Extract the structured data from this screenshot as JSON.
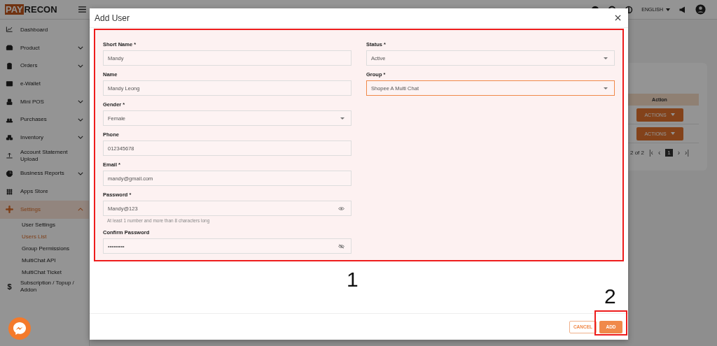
{
  "topbar": {
    "logo": {
      "part_1": "PAY",
      "part_2": "RECON"
    },
    "language": "ENGLISH"
  },
  "sidebar": {
    "items": [
      {
        "label": "Dashboard",
        "selected": false
      },
      {
        "label": "Product",
        "expanded": false,
        "selected": false
      },
      {
        "label": "Orders",
        "expanded": false,
        "selected": false
      },
      {
        "label": "e-Wallet",
        "selected": false
      },
      {
        "label": "Mini POS",
        "expanded": false,
        "selected": false
      },
      {
        "label": "Purchases",
        "expanded": false,
        "selected": false
      },
      {
        "label": "Inventory",
        "expanded": false,
        "selected": false
      },
      {
        "label": "Account Statement Upload",
        "selected": false
      },
      {
        "label": "Business Reports",
        "expanded": false,
        "selected": false
      },
      {
        "label": "Apps Store",
        "selected": false
      },
      {
        "label": "Settings",
        "expanded": true,
        "selected": true,
        "children": [
          {
            "label": "User Settings",
            "selected": false
          },
          {
            "label": "Users List",
            "selected": true
          },
          {
            "label": "Group Permissions",
            "selected": false
          },
          {
            "label": "MultiChat API",
            "selected": false
          },
          {
            "label": "MultiChat Ticket",
            "selected": false
          }
        ]
      },
      {
        "label": "Subscription / Topup / Addon",
        "glyph": "$",
        "selected": false
      }
    ]
  },
  "table": {
    "columns": [
      "Action"
    ],
    "rows": [
      {
        "action": "ACTIONS"
      },
      {
        "action": "ACTIONS"
      }
    ],
    "pagination": {
      "range": "2 of 2",
      "first": "|‹",
      "previous": "‹",
      "current_page": "1",
      "next": "›",
      "last": "›|"
    }
  },
  "dialog": {
    "title": "Add User",
    "left_fields": [
      {
        "kind": "text",
        "label": "Short Name *",
        "value": "Mandy",
        "focused": false
      },
      {
        "kind": "text",
        "label": "Name",
        "value": "Mandy Leong",
        "focused": false
      },
      {
        "kind": "select",
        "label": "Gender *",
        "value": "Female",
        "focused": false
      },
      {
        "kind": "text",
        "label": "Phone",
        "value": "012345678",
        "focused": false
      },
      {
        "kind": "text",
        "label": "Email *",
        "value": "mandy@gmail.com",
        "focused": false
      },
      {
        "kind": "password",
        "label": "Password *",
        "value": "Mandy@123",
        "revealed": true,
        "hint": "At least 1 number and more than 8 characters long",
        "focused": false
      },
      {
        "kind": "password",
        "label": "Confirm Password",
        "value": "•••••••••",
        "revealed": false,
        "focused": false
      }
    ],
    "right_fields": [
      {
        "kind": "select",
        "label": "Status *",
        "value": "Active",
        "focused": false
      },
      {
        "kind": "select",
        "label": "Group *",
        "value": "Shopee A Multi Chat",
        "focused": true
      }
    ],
    "buttons": [
      {
        "kind": "outline",
        "label": "CANCEL"
      },
      {
        "kind": "filled",
        "label": "ADD"
      }
    ]
  },
  "annotations": [
    {
      "label": "1"
    },
    {
      "label": "2"
    }
  ]
}
